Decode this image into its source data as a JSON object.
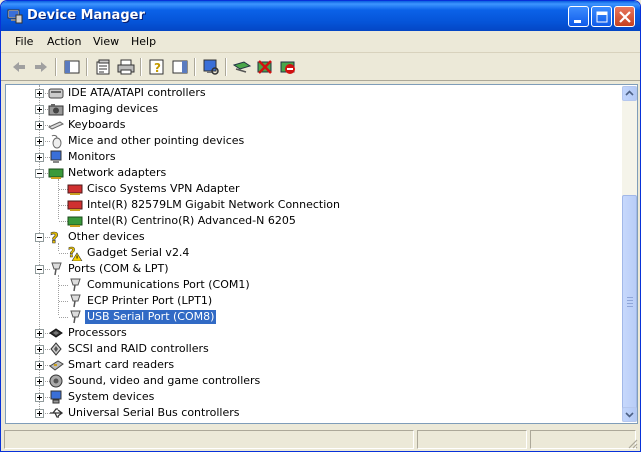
{
  "window": {
    "title": "Device Manager",
    "controls": {
      "minimize": "minimize",
      "maximize": "maximize",
      "close": "close"
    }
  },
  "menu": {
    "items": [
      {
        "label": "File"
      },
      {
        "label": "Action"
      },
      {
        "label": "View"
      },
      {
        "label": "Help"
      }
    ]
  },
  "toolbar": {
    "buttons": [
      {
        "icon": "back-arrow-icon"
      },
      {
        "icon": "forward-arrow-icon"
      },
      {
        "icon": "show-hide-console-tree-icon"
      },
      {
        "icon": "properties-icon"
      },
      {
        "icon": "print-icon"
      },
      {
        "icon": "help-icon"
      },
      {
        "icon": "show-hide-action-pane-icon"
      },
      {
        "icon": "scan-hardware-changes-icon"
      },
      {
        "icon": "update-driver-icon"
      },
      {
        "icon": "disable-device-icon"
      },
      {
        "icon": "uninstall-device-icon"
      }
    ]
  },
  "tree": {
    "nodes": [
      {
        "label": "IDE ATA/ATAPI controllers",
        "icon": "ide-controller-icon",
        "expanded": false
      },
      {
        "label": "Imaging devices",
        "icon": "camera-icon",
        "expanded": false
      },
      {
        "label": "Keyboards",
        "icon": "keyboard-icon",
        "expanded": false
      },
      {
        "label": "Mice and other pointing devices",
        "icon": "mouse-icon",
        "expanded": false
      },
      {
        "label": "Monitors",
        "icon": "monitor-icon",
        "expanded": false
      },
      {
        "label": "Network adapters",
        "icon": "network-card-icon",
        "expanded": true
      },
      {
        "label": "Cisco Systems VPN Adapter",
        "icon": "network-card-icon",
        "child": true
      },
      {
        "label": "Intel(R) 82579LM Gigabit Network Connection",
        "icon": "network-card-icon",
        "child": true
      },
      {
        "label": "Intel(R) Centrino(R) Advanced-N 6205",
        "icon": "network-card-icon",
        "child": true
      },
      {
        "label": "Other devices",
        "icon": "unknown-device-icon",
        "expanded": true
      },
      {
        "label": "Gadget Serial v2.4",
        "icon": "warning-device-icon",
        "child": true
      },
      {
        "label": "Ports (COM & LPT)",
        "icon": "port-icon",
        "expanded": true
      },
      {
        "label": "Communications Port (COM1)",
        "icon": "port-icon",
        "child": true
      },
      {
        "label": "ECP Printer Port (LPT1)",
        "icon": "port-icon",
        "child": true
      },
      {
        "label": "USB Serial Port (COM8)",
        "icon": "port-icon",
        "child": true,
        "selected": true
      },
      {
        "label": "Processors",
        "icon": "processor-icon",
        "expanded": false
      },
      {
        "label": "SCSI and RAID controllers",
        "icon": "scsi-icon",
        "expanded": false
      },
      {
        "label": "Smart card readers",
        "icon": "smart-card-icon",
        "expanded": false
      },
      {
        "label": "Sound, video and game controllers",
        "icon": "sound-icon",
        "expanded": false
      },
      {
        "label": "System devices",
        "icon": "system-device-icon",
        "expanded": false
      },
      {
        "label": "Universal Serial Bus controllers",
        "icon": "usb-icon",
        "expanded": false
      }
    ]
  },
  "status": {
    "pane1": "",
    "pane2": "",
    "pane3": ""
  }
}
